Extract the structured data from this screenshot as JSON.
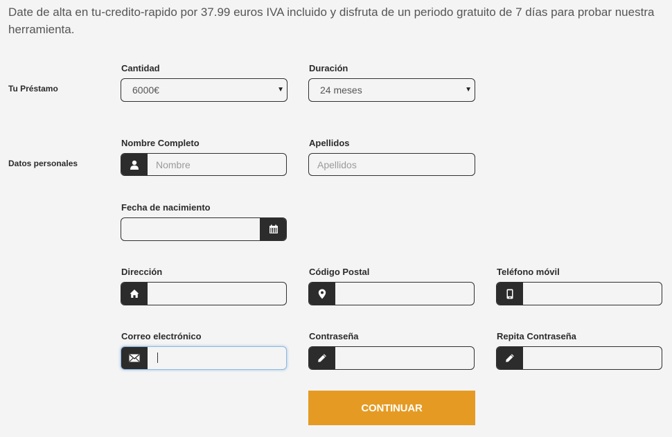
{
  "intro_text": "Date de alta en tu-credito-rapido por 37.99 euros IVA incluido y disfruta de un periodo gratuito de 7 días para probar nuestra herramienta.",
  "sections": {
    "loan": "Tu Préstamo",
    "personal": "Datos personales"
  },
  "loan": {
    "amount_label": "Cantidad",
    "amount_value": "6000€",
    "duration_label": "Duración",
    "duration_value": "24 meses"
  },
  "personal": {
    "full_name_label": "Nombre Completo",
    "full_name_placeholder": "Nombre",
    "surname_label": "Apellidos",
    "surname_placeholder": "Apellidos",
    "birthdate_label": "Fecha de nacimiento",
    "address_label": "Dirección",
    "postal_label": "Código Postal",
    "phone_label": "Teléfono móvil",
    "email_label": "Correo electrónico",
    "password_label": "Contraseña",
    "repeat_password_label": "Repita Contraseña"
  },
  "icons": {
    "user": "user-icon",
    "calendar": "calendar-icon",
    "home": "home-icon",
    "location": "map-marker-icon",
    "phone": "mobile-phone-icon",
    "email": "envelope-icon",
    "password": "pencil-icon",
    "repeat_password": "pencil-icon"
  },
  "colors": {
    "button": "#e59b23",
    "addon": "#2c2c2c",
    "background": "#f4f4f4",
    "focus": "#8fb8e0"
  },
  "submit_label": "CONTINUAR"
}
